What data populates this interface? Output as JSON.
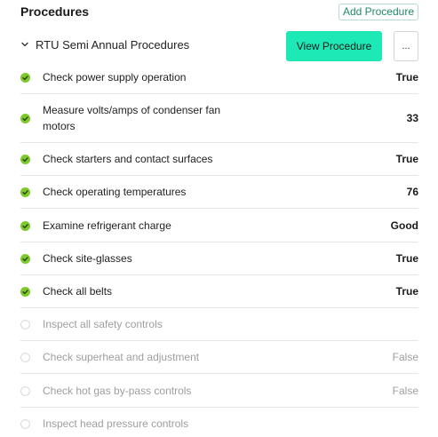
{
  "header": {
    "title": "Procedures",
    "add_label": "Add Procedure"
  },
  "group": {
    "title": "RTU Semi Annual Procedures",
    "view_label": "View Procedure",
    "more_label": "..."
  },
  "colors": {
    "accent": "#1de9b6",
    "check_done": "#7dc82b",
    "pending_circle": "#d9d9d9",
    "link_green": "#1f8a65"
  },
  "icons": {
    "collapse": "chevron-down-icon",
    "done": "check-circle-icon",
    "pending": "empty-circle-icon"
  },
  "items": [
    {
      "label": "Check power supply operation",
      "value": "True",
      "done": true
    },
    {
      "label": "Measure volts/amps of condenser fan motors",
      "value": "33",
      "done": true
    },
    {
      "label": "Check starters and contact surfaces",
      "value": "True",
      "done": true
    },
    {
      "label": "Check operating temperatures",
      "value": "76",
      "done": true
    },
    {
      "label": "Examine refrigerant charge",
      "value": "Good",
      "done": true
    },
    {
      "label": "Check site-glasses",
      "value": "True",
      "done": true
    },
    {
      "label": "Check all belts",
      "value": "True",
      "done": true
    },
    {
      "label": "Inspect all safety controls",
      "value": "",
      "done": false
    },
    {
      "label": "Check superheat and adjustment",
      "value": "False",
      "done": false
    },
    {
      "label": "Check hot gas by-pass controls",
      "value": "False",
      "done": false
    },
    {
      "label": "Inspect head pressure controls",
      "value": "",
      "done": false
    }
  ]
}
